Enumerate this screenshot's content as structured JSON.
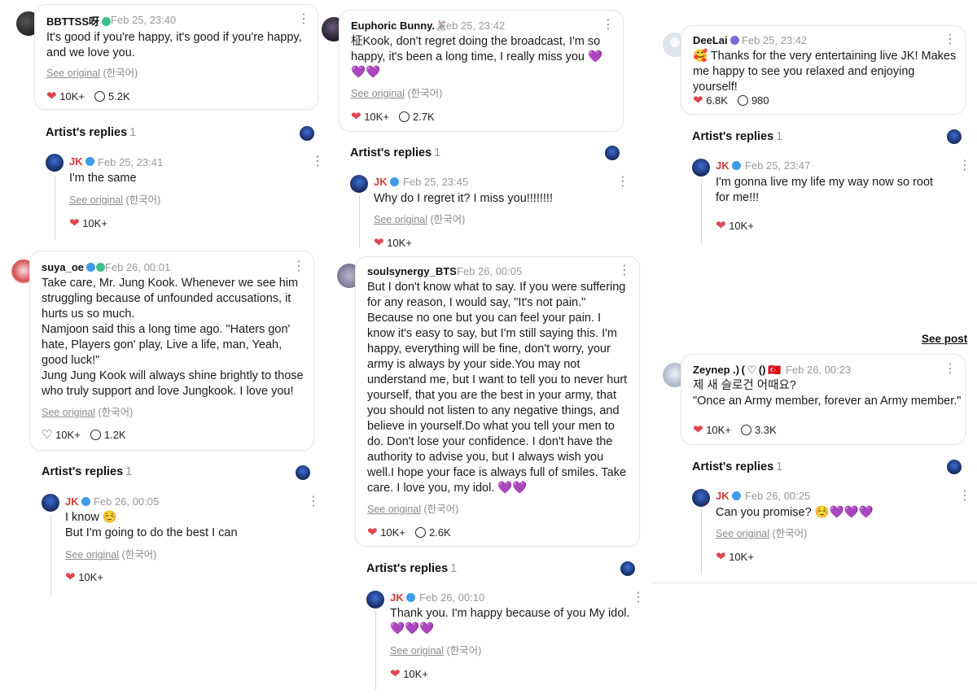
{
  "common": {
    "see_original": "See original",
    "lang": "(한국어)",
    "artist_replies": "Artist's replies",
    "see_post": "See post"
  },
  "col1": {
    "c1": {
      "name": "BBTTSS呀",
      "time": "Feb 25, 23:40",
      "text": "It's good if you're happy, it's good if you're happy, and we love you.",
      "likes": "10K+",
      "comments": "5.2K"
    },
    "r1": {
      "count": "1",
      "name": "JK",
      "time": "Feb 25, 23:41",
      "text": "I'm the same",
      "likes": "10K+"
    },
    "c2": {
      "name": "suya_oe",
      "time": "Feb 26, 00:01",
      "text": "Take care, Mr. Jung Kook. Whenever we see him struggling because of unfounded accusations, it hurts us so much.\nNamjoon said this a long time ago. \"Haters gon' hate, Players gon' play, Live a life, man, Yeah, good luck!\"\nJung Jung Kook will always shine brightly to those who truly support and love Jungkook. I love you!",
      "likes": "10K+",
      "comments": "1.2K"
    },
    "r2": {
      "count": "1",
      "name": "JK",
      "time": "Feb 26, 00:05",
      "text": "I know ☺️\nBut I'm going to do the best I can",
      "likes": "10K+"
    }
  },
  "col2": {
    "c1": {
      "name": "Euphoric Bunny.🐰",
      "time": "Feb 25, 23:42",
      "text": "柾Kook, don't regret doing the broadcast, I'm so happy, it's been a long time, I really miss you 💜💜💜",
      "likes": "10K+",
      "comments": "2.7K"
    },
    "r1": {
      "count": "1",
      "name": "JK",
      "time": "Feb 25, 23:45",
      "text": "Why do I regret it? I miss you!!!!!!!!",
      "likes": "10K+"
    },
    "c2": {
      "name": "soulsynergy_BTS",
      "time": "Feb 26, 00:05",
      "text": "But I don't know what to say. If you were suffering for any reason, I would say, \"It's not pain.\" Because no one but you can feel your pain. I know it's easy to say, but I'm still saying this. I'm happy, everything will be fine, don't worry, your army is always by your side.You may not understand me, but I want to tell you to never hurt yourself, that you are the best in your army, that you should not listen to any negative things, and believe in yourself.Do what you tell your men to do. Don't lose your confidence. I don't have the authority to advise you, but I always wish you well.I hope your face is always full of smiles. Take care. I love you, my idol. 💜💜",
      "likes": "10K+",
      "comments": "2.6K"
    },
    "r2": {
      "count": "1",
      "name": "JK",
      "time": "Feb 26, 00:10",
      "text": "Thank you. I'm happy because of you My idol.\n💜💜💜",
      "likes": "10K+"
    }
  },
  "col3": {
    "c1": {
      "name": "DeeLai",
      "time": "Feb 25, 23:42",
      "text": "🥰 Thanks for the very entertaining live JK!  Makes me happy to see you relaxed and enjoying yourself!",
      "likes": "6.8K",
      "comments": "980"
    },
    "r1": {
      "count": "1",
      "name": "JK",
      "time": "Feb 25, 23:47",
      "text": "I'm gonna live my life my way now so root for me!!!",
      "likes": "10K+"
    },
    "c2": {
      "name": "Zeynep .) ( ♡ () 🇹🇷",
      "time": "Feb 26, 00:23",
      "text": "제 새 슬로건 어때요?\n\"Once an Army member, forever an Army member.\"",
      "likes": "10K+",
      "comments": "3.3K"
    },
    "r2": {
      "count": "1",
      "name": "JK",
      "time": "Feb 26, 00:25",
      "text": "Can you promise? ☺️💜💜💜",
      "likes": "10K+"
    }
  },
  "icons": [
    "heart-icon",
    "comment-icon",
    "more-icon",
    "verified-badge-icon"
  ],
  "colors": {
    "heart": "#e0464e",
    "jk_name": "#d23a3a",
    "verified": "#3d9be9",
    "muted": "#999999"
  }
}
